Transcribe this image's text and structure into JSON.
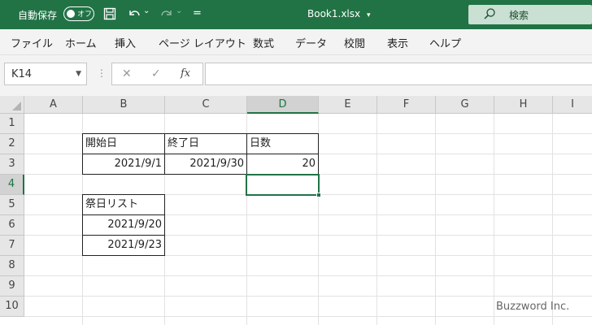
{
  "titlebar": {
    "autosave_label": "自動保存",
    "autosave_state": "オフ",
    "file_name": "Book1.xlsx",
    "file_caret": "▾",
    "search_label": "検索",
    "qat_more": "=",
    "undo_caret": "⌄",
    "redo_caret": "⌄"
  },
  "menu": [
    "ファイル",
    "ホーム",
    "挿入",
    "ページ レイアウト",
    "数式",
    "データ",
    "校閲",
    "表示",
    "ヘルプ"
  ],
  "formula_bar": {
    "name_box": "K14",
    "cancel": "✕",
    "enter": "✓",
    "fx": "fx",
    "grip": "⋮",
    "formula": ""
  },
  "grid": {
    "columns": [
      "A",
      "B",
      "C",
      "D",
      "E",
      "F",
      "G",
      "H",
      "I"
    ],
    "rows": [
      "1",
      "2",
      "3",
      "4",
      "5",
      "6",
      "7",
      "8",
      "9",
      "10"
    ],
    "selected_column": "D",
    "selected_row": "4",
    "cells": {
      "B2": "開始日",
      "C2": "終了日",
      "D2": "日数",
      "B3": "2021/9/1",
      "C3": "2021/9/30",
      "D3": "20",
      "B5": "祭日リスト",
      "B6": "2021/9/20",
      "B7": "2021/9/23"
    }
  },
  "watermark": "Buzzword Inc.",
  "colors": {
    "excel_green": "#217346",
    "search_bg": "#c9e0d2"
  },
  "icons": [
    "save-icon",
    "undo-icon",
    "redo-icon",
    "search-icon",
    "cancel-icon",
    "enter-icon",
    "fx-icon"
  ]
}
